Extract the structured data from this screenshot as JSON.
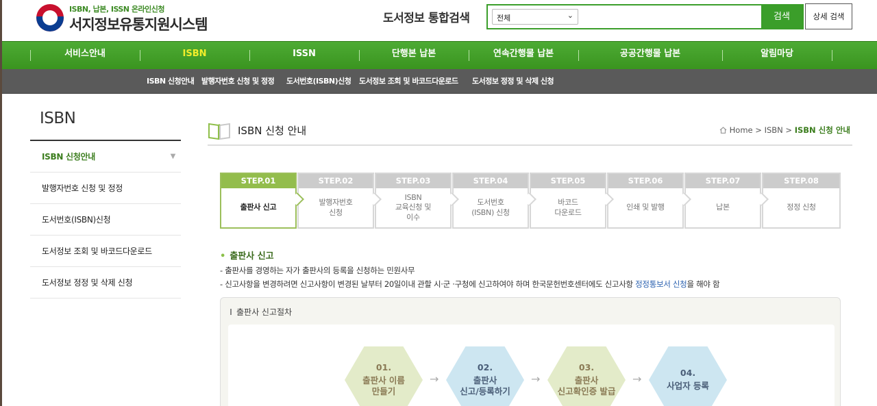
{
  "header": {
    "logo_sub": "ISBN, 납본, ISSN 온라인신청",
    "logo_title": "서지정보유통지원시스템",
    "search_title": "도서정보 통합검색",
    "search_select": "전체",
    "search_input_value": "",
    "search_button": "검색",
    "detail_search_button": "상세 검색"
  },
  "gnb": [
    {
      "label": "서비스안내",
      "active": false
    },
    {
      "label": "ISBN",
      "active": true
    },
    {
      "label": "ISSN",
      "active": false
    },
    {
      "label": "단행본 납본",
      "active": false
    },
    {
      "label": "연속간행물 납본",
      "active": false
    },
    {
      "label": "공공간행물 납본",
      "active": false
    },
    {
      "label": "알림마당",
      "active": false
    }
  ],
  "subgnb": [
    "ISBN 신청안내",
    "발행자번호 신청 및 정정",
    "도서번호(ISBN)신청",
    "도서정보 조회 및 바코드다운로드",
    "도서정보 정정 및 삭제 신청"
  ],
  "sidebar": {
    "title": "ISBN",
    "items": [
      {
        "label": "ISBN 신청안내",
        "active": true
      },
      {
        "label": "발행자번호 신청 및 정정",
        "active": false
      },
      {
        "label": "도서번호(ISBN)신청",
        "active": false
      },
      {
        "label": "도서정보 조회 및 바코드다운로드",
        "active": false
      },
      {
        "label": "도서정보 정정 및 삭제 신청",
        "active": false
      }
    ]
  },
  "content": {
    "title": "ISBN 신청 안내",
    "breadcrumb": {
      "home": "Home",
      "sep1": ">",
      "level1": "ISBN",
      "sep2": ">",
      "current": "ISBN 신청 안내"
    }
  },
  "steps": [
    {
      "head": "STEP.01",
      "lines": [
        "출판사 신고"
      ],
      "active": true
    },
    {
      "head": "STEP.02",
      "lines": [
        "발행자번호",
        "신청"
      ],
      "active": false
    },
    {
      "head": "STEP.03",
      "lines": [
        "ISBN",
        "교육신청 및",
        "이수"
      ],
      "active": false
    },
    {
      "head": "STEP.04",
      "lines": [
        "도서번호",
        "(ISBN) 신청"
      ],
      "active": false
    },
    {
      "head": "STEP.05",
      "lines": [
        "바코드",
        "다운로드"
      ],
      "active": false
    },
    {
      "head": "STEP.06",
      "lines": [
        "인쇄 및 발행"
      ],
      "active": false
    },
    {
      "head": "STEP.07",
      "lines": [
        "납본"
      ],
      "active": false
    },
    {
      "head": "STEP.08",
      "lines": [
        "정정 신청"
      ],
      "active": false
    }
  ],
  "section": {
    "title": "출판사 신고",
    "desc1": "- 출판사를 경영하는 자가 출판사의 등록을 신청하는 민원사무",
    "desc2_pre": "- 신고사항을 변경하려면 신고사항이 변경된 날부터 20일이내 관할 시·군 ·구청에 신고하여야 하며 한국문헌번호센터에도 신고사항 ",
    "desc2_link": "정정통보서 신청",
    "desc2_post": "을 해야 함",
    "procedure_title": "출판사 신고절차",
    "procedure": [
      {
        "num": "01.",
        "lines": [
          "출판사 이름",
          "만들기"
        ],
        "color": "green"
      },
      {
        "num": "02.",
        "lines": [
          "출판사",
          "신고/등록하기"
        ],
        "color": "blue"
      },
      {
        "num": "03.",
        "lines": [
          "출판사",
          "신고확인증 발급"
        ],
        "color": "green"
      },
      {
        "num": "04.",
        "lines": [
          "사업자 등록"
        ],
        "color": "blue"
      }
    ],
    "arrow_glyph": "→"
  }
}
